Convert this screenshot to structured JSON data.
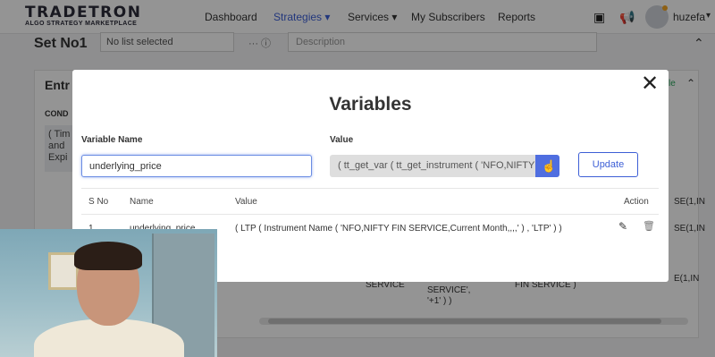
{
  "navbar": {
    "logo_main": "TRADETRON",
    "logo_sub": "ALGO STRATEGY MARKETPLACE",
    "items": [
      "Dashboard",
      "Strategies",
      "Services",
      "My Subscribers",
      "Reports"
    ],
    "active_item": "Strategies",
    "user_name": "huzefa"
  },
  "background": {
    "set_title": "Set No1",
    "select_value": "No list selected",
    "description_placeholder": "Description",
    "entry_title": "Entr",
    "condition_label": "COND",
    "condition_text": "( Tim and Expi",
    "right_link": "le",
    "right_cells": [
      "SE(1,IN",
      "SE(1,IN",
      "E(1,IN"
    ],
    "mid_cells": [
      "SERVICE",
      "SERVICE', '+1' ) )",
      "FIN SERVICE )"
    ]
  },
  "modal": {
    "title": "Variables",
    "variable_name_label": "Variable Name",
    "variable_name_value": "underlying_price",
    "value_label": "Value",
    "value_text": "( tt_get_var ( tt_get_instrument ( 'NFO,NIFTY",
    "update_label": "Update",
    "table": {
      "headers": [
        "S No",
        "Name",
        "Value",
        "Action"
      ],
      "rows": [
        {
          "sno": "1",
          "name": "underlying_price",
          "value": "( LTP ( Instrument Name ( 'NFO,NIFTY FIN SERVICE,Current Month,,,,' ) , 'LTP' ) )"
        }
      ]
    }
  },
  "colors": {
    "accent": "#4f6ee0",
    "active_nav": "#3c5fd7",
    "overlay": "rgba(0,0,0,0.42)"
  }
}
